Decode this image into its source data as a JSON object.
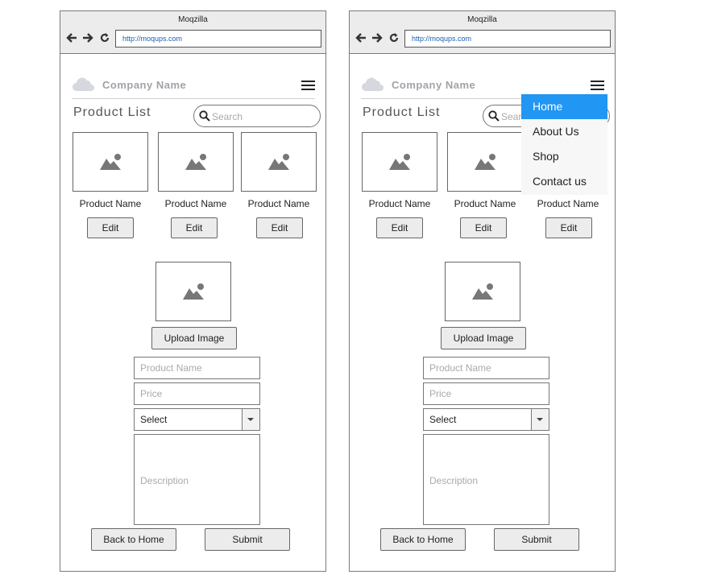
{
  "browser": {
    "title": "Moqzilla",
    "url": "http://moqups.com"
  },
  "header": {
    "company_name": "Company Name"
  },
  "page": {
    "title": "Product List"
  },
  "search": {
    "placeholder": "Search"
  },
  "products": [
    {
      "name": "Product Name",
      "edit_label": "Edit"
    },
    {
      "name": "Product Name",
      "edit_label": "Edit"
    },
    {
      "name": "Product Name",
      "edit_label": "Edit"
    }
  ],
  "form": {
    "upload_label": "Upload Image",
    "product_name_placeholder": "Product Name",
    "price_placeholder": "Price",
    "select_value": "Select",
    "description_placeholder": "Description",
    "back_label": "Back to Home",
    "submit_label": "Submit"
  },
  "nav_menu": {
    "items": [
      {
        "label": "Home",
        "active": true
      },
      {
        "label": "About Us"
      },
      {
        "label": "Shop"
      },
      {
        "label": "Contact us"
      }
    ],
    "active_color": "#2196f3"
  }
}
